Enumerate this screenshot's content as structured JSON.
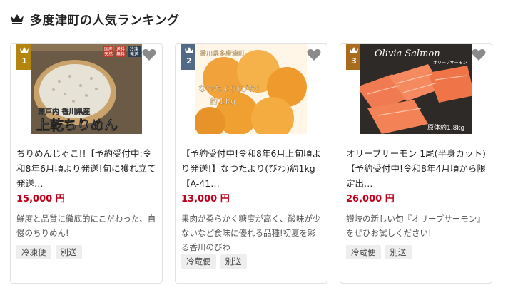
{
  "header": {
    "title": "多度津町の人気ランキング",
    "icon": "crown-icon"
  },
  "colors": {
    "gold": "#b5860d",
    "silver": "#526a86",
    "bronze": "#a96b1c",
    "price": "#c0001b"
  },
  "cards": [
    {
      "rank": "1",
      "image_caption_sub": "瀬戸内 香川県産",
      "image_caption_main": "上乾ちりめん",
      "image_labels": [
        "国産",
        "天然",
        "送料",
        "無料",
        "冷凍",
        "発送"
      ],
      "name": "ちりめんじゃこ!!【予約受付中:令和8年6月頃より発送!旬に獲れ立て発送…",
      "price": "15,000 円",
      "description": "鮮度と品質に徹底的にこだわった、自慢のちりめん!",
      "tags": [
        "冷凍便",
        "別送"
      ]
    },
    {
      "rank": "2",
      "image_caption_top": "香川県多度津町",
      "image_caption_mid": "なつたより(びわ)",
      "image_caption_bottom": "約１Kg",
      "name": "【予約受付中!令和8年6月上旬頃より発送!】なつたより(びわ)約1kg【A-41…",
      "price": "13,000 円",
      "description": "果肉が柔らかく糖度が高く、酸味が少ないなど食味に優れる品種!初夏を彩る香川のびわ",
      "tags": [
        "冷蔵便",
        "別送"
      ]
    },
    {
      "rank": "3",
      "image_caption_top": "Olivia Salmon",
      "image_caption_sub": "オリーブサーモン",
      "image_caption_bottom": "原体約1.8kg",
      "name": "オリーブサーモン 1尾(半身カット)【予約受付中!令和8年4月頃から限定出…",
      "price": "26,000 円",
      "description": "讃岐の新しい旬『オリーブサーモン』をぜひお試しください!",
      "tags": [
        "冷蔵便",
        "別送"
      ]
    }
  ]
}
